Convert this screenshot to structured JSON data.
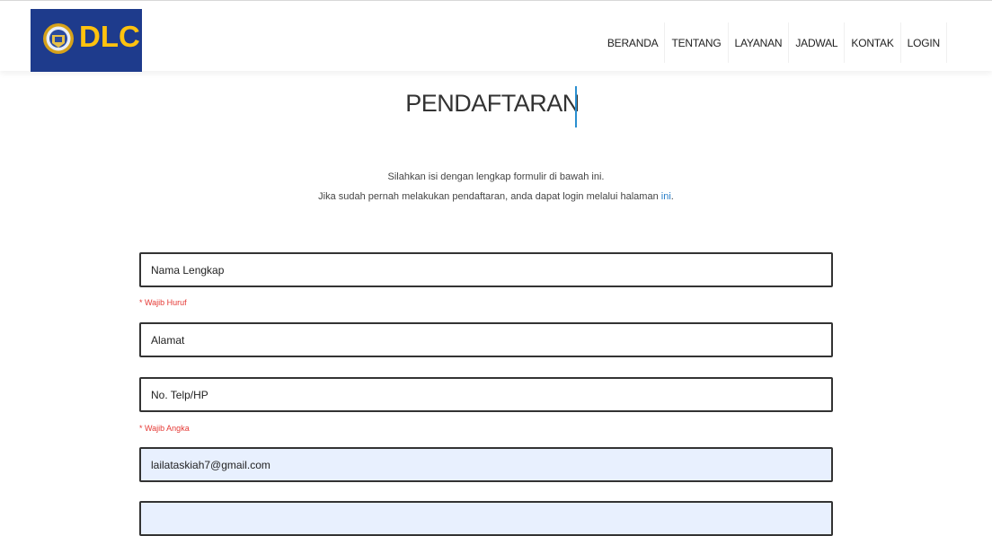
{
  "header": {
    "logo_text": "DLC",
    "nav": [
      "BERANDA",
      "TENTANG",
      "LAYANAN",
      "JADWAL",
      "KONTAK",
      "LOGIN"
    ]
  },
  "page": {
    "title": "PENDAFTARAN",
    "intro_line1": "Silahkan isi dengan lengkap formulir di bawah ini.",
    "intro_line2_prefix": "Jika sudah pernah melakukan pendaftaran, anda dapat login melalui halaman ",
    "intro_link": "ini",
    "intro_line2_suffix": "."
  },
  "form": {
    "name_placeholder": "Nama Lengkap",
    "name_hint": "* Wajib Huruf",
    "address_placeholder": "Alamat",
    "phone_placeholder": "No. Telp/HP",
    "phone_hint": "* Wajib Angka",
    "email_value": "lailataskiah7@gmail.com",
    "password_value": ""
  },
  "colors": {
    "logo_bg": "#1e3b8c",
    "logo_text": "#ffc20e",
    "accent": "#2a8fd0",
    "hint": "#e53935",
    "autofill_bg": "#e8f0fe"
  }
}
